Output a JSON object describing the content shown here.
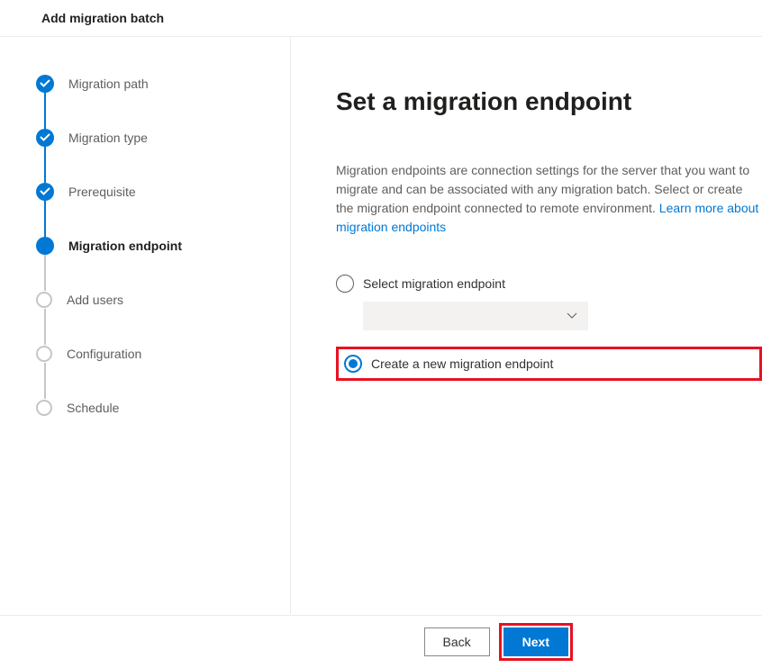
{
  "header": {
    "title": "Add migration batch"
  },
  "steps": [
    {
      "label": "Migration path",
      "state": "completed"
    },
    {
      "label": "Migration type",
      "state": "completed"
    },
    {
      "label": "Prerequisite",
      "state": "completed"
    },
    {
      "label": "Migration endpoint",
      "state": "current"
    },
    {
      "label": "Add users",
      "state": "pending"
    },
    {
      "label": "Configuration",
      "state": "pending"
    },
    {
      "label": "Schedule",
      "state": "pending"
    }
  ],
  "main": {
    "title": "Set a migration endpoint",
    "description_part1": "Migration endpoints are connection settings for the server that you want to migrate and can be associated with any migration batch. Select or create the migration endpoint connected to remote environment. ",
    "learn_more_link": "Learn more about migration endpoints",
    "radio_options": {
      "select": "Select migration endpoint",
      "create": "Create a new migration endpoint"
    }
  },
  "footer": {
    "back_label": "Back",
    "next_label": "Next"
  }
}
